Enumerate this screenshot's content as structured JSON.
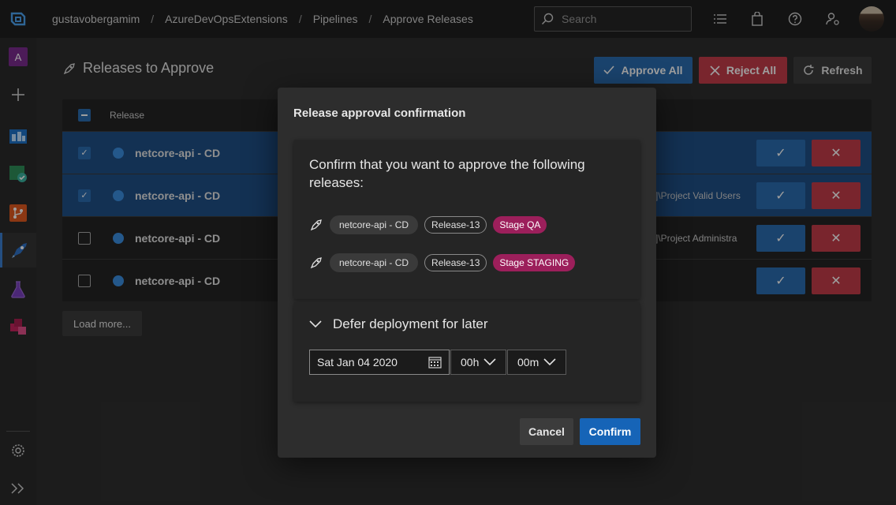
{
  "topbar": {
    "breadcrumbs": [
      "gustavobergamim",
      "AzureDevOpsExtensions",
      "Pipelines",
      "Approve Releases"
    ],
    "separator": "/",
    "search_placeholder": "Search",
    "icons": [
      "list-icon",
      "shopping-bag-icon",
      "help-icon",
      "user-settings-icon"
    ]
  },
  "rail": {
    "project_initial": "A",
    "items": [
      "add-icon",
      "boards-icon",
      "test-plans-icon",
      "repos-icon",
      "pipelines-icon",
      "test-flask-icon",
      "artifacts-icon",
      "settings-icon",
      "expand-icon"
    ]
  },
  "page": {
    "title": "Releases to Approve",
    "approve_all": "Approve All",
    "reject_all": "Reject All",
    "refresh": "Refresh",
    "column_release": "Release",
    "rows": [
      {
        "name": "netcore-api - CD",
        "extra": "",
        "selected": true
      },
      {
        "name": "netcore-api - CD",
        "extra": "]\\Project Valid Users",
        "selected": true
      },
      {
        "name": "netcore-api - CD",
        "extra": "]\\Project Administra",
        "selected": false
      },
      {
        "name": "netcore-api - CD",
        "extra": "",
        "selected": false
      }
    ],
    "load_more": "Load more..."
  },
  "dialog": {
    "title": "Release approval confirmation",
    "confirm_text": "Confirm that you want to approve the following releases:",
    "releases": [
      {
        "definition": "netcore-api - CD",
        "release": "Release-13",
        "stage": "Stage QA"
      },
      {
        "definition": "netcore-api - CD",
        "release": "Release-13",
        "stage": "Stage STAGING"
      }
    ],
    "defer_label": "Defer deployment for later",
    "date_value": "Sat Jan 04 2020",
    "hour_value": "00h",
    "minute_value": "00m",
    "cancel": "Cancel",
    "confirm": "Confirm"
  },
  "colors": {
    "accent": "#2b6cb0",
    "reject": "#c43c4a",
    "stage_pill": "#9c1f5b",
    "confirm": "#1664b7"
  }
}
